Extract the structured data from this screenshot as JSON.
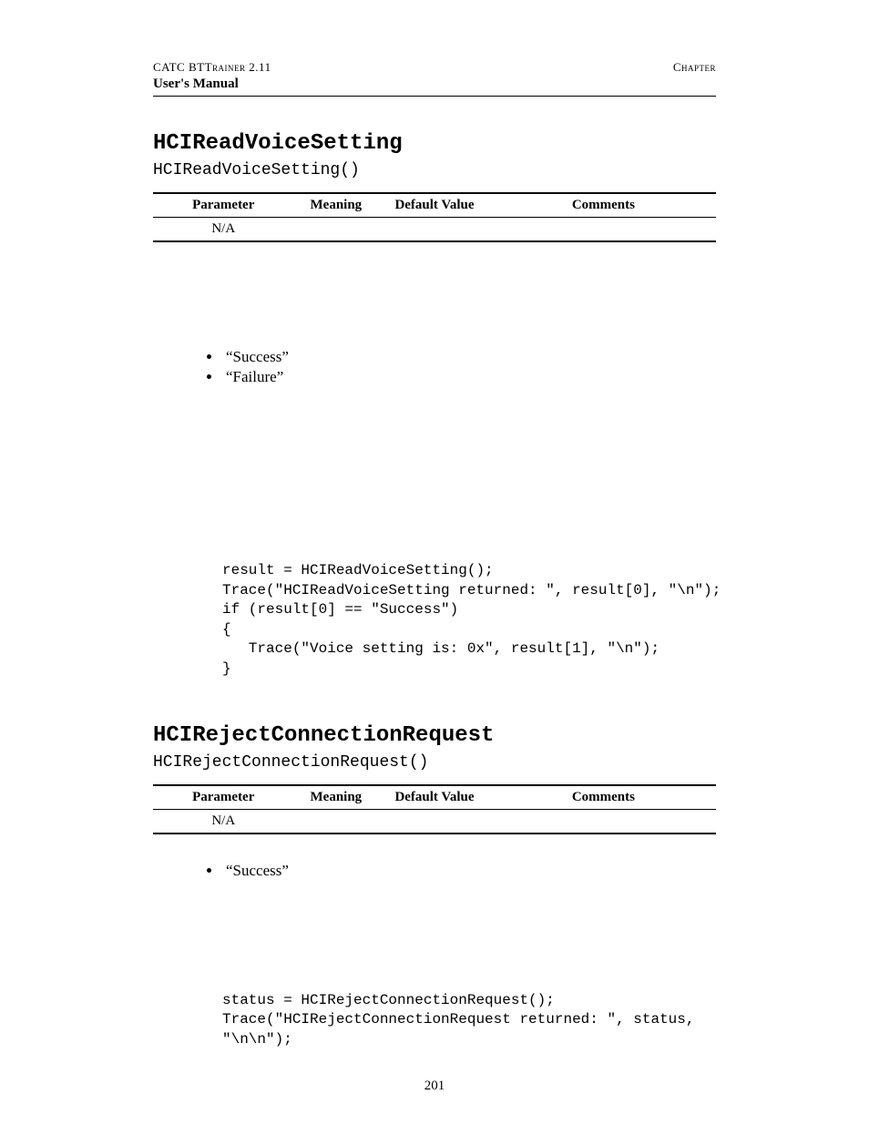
{
  "header": {
    "left_prefix": "CATC BT",
    "left_smallcaps": "Trainer",
    "left_version": " 2.11",
    "right": "Chapter",
    "subtitle": "User's Manual"
  },
  "sections": [
    {
      "title": "HCIReadVoiceSetting",
      "signature": "HCIReadVoiceSetting()",
      "table": {
        "headers": [
          "Parameter",
          "Meaning",
          "Default Value",
          "Comments"
        ],
        "row": [
          "N/A",
          "",
          "",
          ""
        ]
      },
      "returns": [
        "“Success”",
        "“Failure”"
      ],
      "code": "result = HCIReadVoiceSetting();\nTrace(\"HCIReadVoiceSetting returned: \", result[0], \"\\n\");\nif (result[0] == \"Success\")\n{\n   Trace(\"Voice setting is: 0x\", result[1], \"\\n\");\n}"
    },
    {
      "title": "HCIRejectConnectionRequest",
      "signature": "HCIRejectConnectionRequest()",
      "table": {
        "headers": [
          "Parameter",
          "Meaning",
          "Default Value",
          "Comments"
        ],
        "row": [
          "N/A",
          "",
          "",
          ""
        ]
      },
      "returns": [
        "“Success”"
      ],
      "code": "status = HCIRejectConnectionRequest();\nTrace(\"HCIRejectConnectionRequest returned: \", status,\n\"\\n\\n\");"
    }
  ],
  "page_number": "201"
}
